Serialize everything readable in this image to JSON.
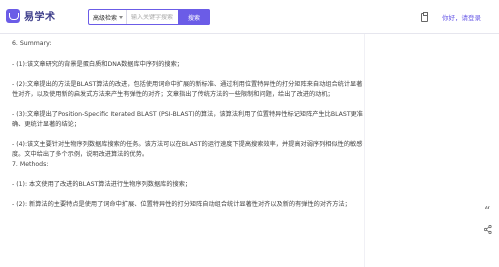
{
  "header": {
    "logo_text": "易学术",
    "search_type": "高级检索",
    "search_placeholder": "输入关键字搜索",
    "search_button": "搜索",
    "login_link": "你好，请登录"
  },
  "content": {
    "summary_heading": "6. Summary:",
    "summary_items": [
      "- (1):该文章研究的背景是蛋白质和DNA数据库中序列的搜索；",
      "- (2):文章提出的方法是BLAST算法的改进，包括使用词命中扩展的新标准、通过利用位置特异性的打分矩阵来自动组合统计显著性对齐，以及使用新的启发式方法来产生有弹性的对齐；文章指出了传统方法的一些限制和问题，给出了改进的动机；",
      "- (3):文章提出了Position-Specific Iterated BLAST (PSI-BLAST)的算法，该算法利用了位置特异性标记矩阵产生比BLAST更准确、更统计显著的结论；",
      "- (4):该文主要针对生物序列数据库搜索的任务。该方法可以在BLAST的运行速度下提高搜索效率，并提高对弱序列相似性的敏感度。文中给出了多个示例，说明改进算法的优势。"
    ],
    "methods_heading": "7. Methods:",
    "methods_items": [
      "- (1): 本文使用了改进的BLAST算法进行生物序列数据库的搜索；",
      "- (2): 新算法的主要特点是使用了词命中扩展、位置特异性的打分矩阵自动组合统计显著性对齐以及新的有弹性的对齐方法；"
    ]
  },
  "side_icons": {
    "quote_glyph": "“"
  }
}
